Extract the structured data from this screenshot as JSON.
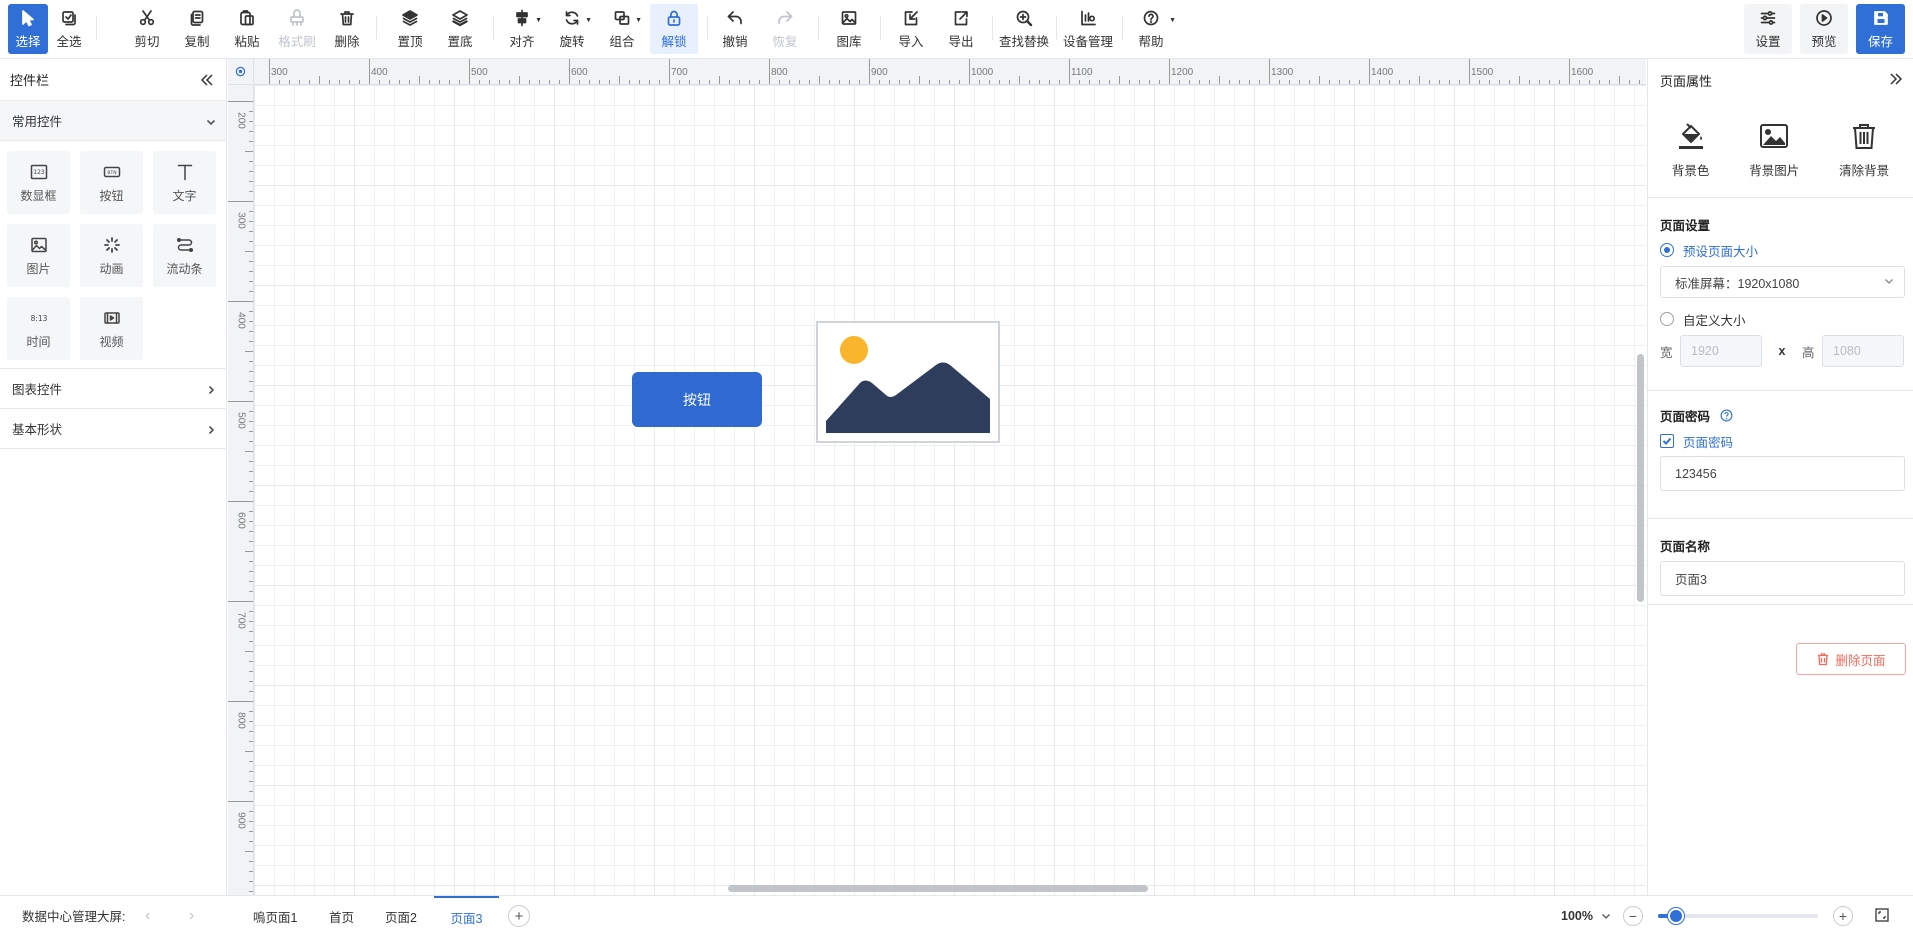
{
  "toolbar": {
    "items": [
      {
        "label": "选择",
        "icon": "cursor-icon"
      },
      {
        "label": "全选",
        "icon": "select-all-icon"
      },
      {
        "label": "剪切",
        "icon": "scissors-icon"
      },
      {
        "label": "复制",
        "icon": "copy-icon"
      },
      {
        "label": "粘贴",
        "icon": "paste-icon"
      },
      {
        "label": "格式刷",
        "icon": "format-brush-icon"
      },
      {
        "label": "删除",
        "icon": "trash-icon"
      },
      {
        "label": "置顶",
        "icon": "bring-to-front-icon"
      },
      {
        "label": "置底",
        "icon": "send-to-back-icon"
      },
      {
        "label": "对齐",
        "icon": "align-icon"
      },
      {
        "label": "旋转",
        "icon": "rotate-icon"
      },
      {
        "label": "组合",
        "icon": "group-icon"
      },
      {
        "label": "解锁",
        "icon": "unlock-icon"
      },
      {
        "label": "撤销",
        "icon": "undo-icon"
      },
      {
        "label": "恢复",
        "icon": "redo-icon"
      },
      {
        "label": "图库",
        "icon": "gallery-icon"
      },
      {
        "label": "导入",
        "icon": "import-icon"
      },
      {
        "label": "导出",
        "icon": "export-icon"
      },
      {
        "label": "查找替换",
        "icon": "find-replace-icon"
      },
      {
        "label": "设备管理",
        "icon": "device-manage-icon"
      },
      {
        "label": "帮助",
        "icon": "help-icon"
      }
    ],
    "right": [
      {
        "label": "设置",
        "icon": "settings-icon"
      },
      {
        "label": "预览",
        "icon": "play-icon"
      },
      {
        "label": "保存",
        "icon": "save-icon"
      }
    ]
  },
  "left_panel": {
    "title": "控件栏",
    "common_section": "常用控件",
    "widgets": [
      {
        "label": "数显框",
        "icon": "numeric-display-icon"
      },
      {
        "label": "按钮",
        "icon": "button-widget-icon"
      },
      {
        "label": "文字",
        "icon": "text-icon"
      },
      {
        "label": "图片",
        "icon": "image-icon"
      },
      {
        "label": "动画",
        "icon": "animation-icon"
      },
      {
        "label": "流动条",
        "icon": "flow-bar-icon"
      },
      {
        "label": "时间",
        "icon": "time-icon"
      },
      {
        "label": "视频",
        "icon": "video-icon"
      }
    ],
    "chart_section": "图表控件",
    "shape_section": "基本形状"
  },
  "canvas": {
    "h_ruler": [
      "300",
      "400",
      "500",
      "600",
      "700",
      "800",
      "900",
      "1000",
      "1100",
      "1200",
      "1300",
      "1400",
      "1500",
      "1600"
    ],
    "v_ruler": [
      "200",
      "300",
      "400",
      "500",
      "600",
      "700",
      "800",
      "900"
    ],
    "button_widget_label": "按钮",
    "sun_color": "#f9b52c",
    "mountain_color": "#2e3d5c"
  },
  "right_panel": {
    "title": "页面属性",
    "bg_color": "背景色",
    "bg_image": "背景图片",
    "clear_bg": "清除背景",
    "page_settings": "页面设置",
    "preset_size": "预设页面大小",
    "preset_value": "标准屏幕：1920x1080",
    "custom_size": "自定义大小",
    "width_label": "宽",
    "width_placeholder": "1920",
    "x_sep": "x",
    "height_label": "高",
    "height_placeholder": "1080",
    "password_title": "页面密码",
    "password_checkbox": "页面密码",
    "password_value": "123456",
    "name_title": "页面名称",
    "name_value": "页面3",
    "delete_page": "删除页面"
  },
  "bottom": {
    "project": "数据中心管理大屏:",
    "pages": [
      "嗚页面1",
      "首页",
      "页面2",
      "页面3"
    ],
    "active_page": "页面3",
    "zoom": "100%",
    "zoom_fraction": 0.06
  },
  "colors": {
    "accent": "#2f6fd6",
    "danger": "#f06b5c"
  }
}
